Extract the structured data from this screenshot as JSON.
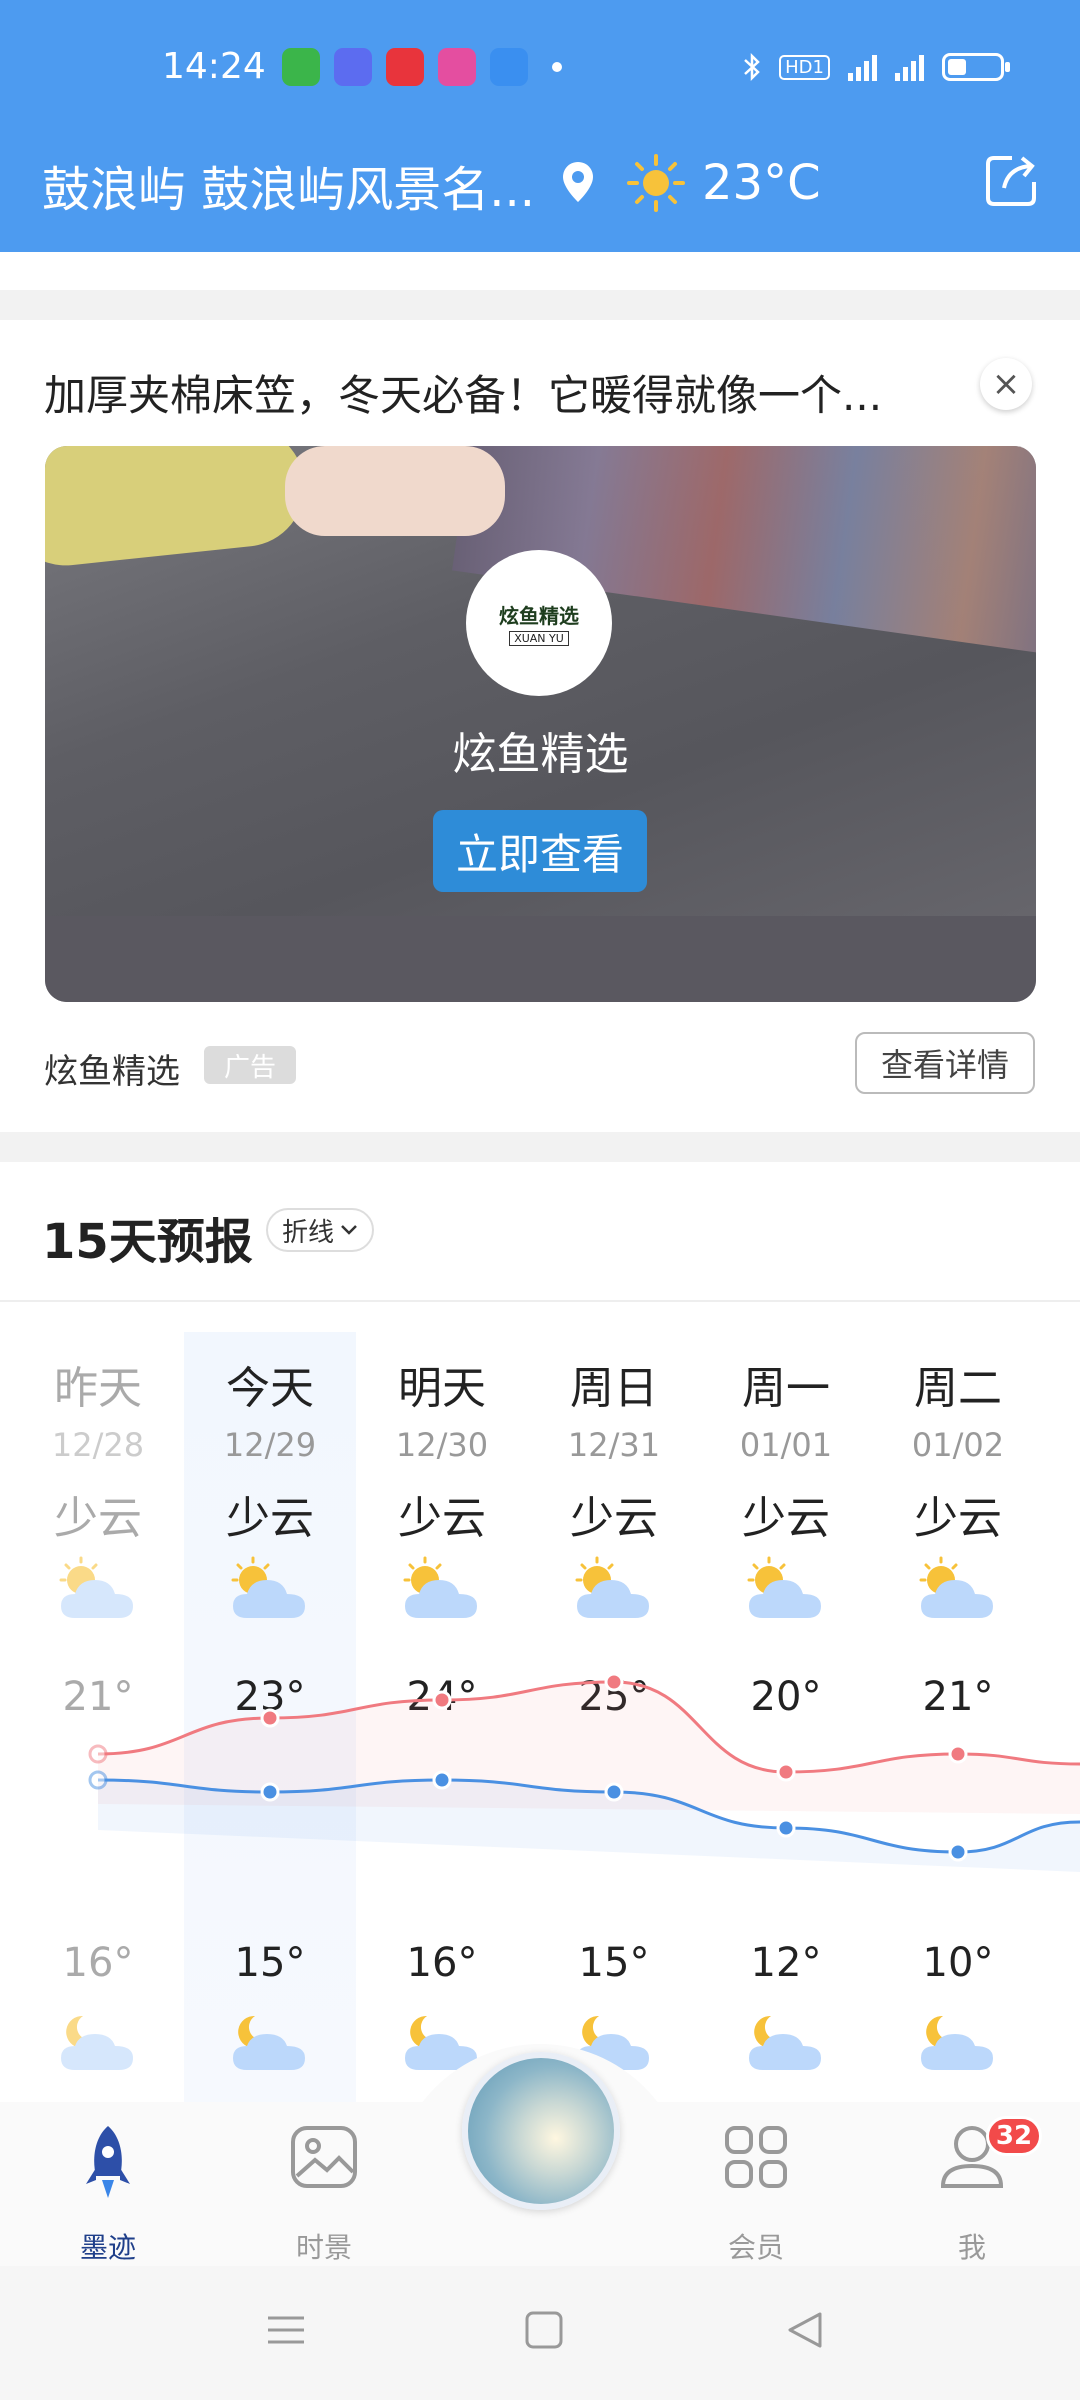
{
  "status_bar": {
    "time": "14:24",
    "app_icons": [
      "#3bb54a",
      "#5c6cf0",
      "#e8343c",
      "#e44ea0",
      "#3a8ff0"
    ],
    "network": "4G",
    "hd_label": "HD1"
  },
  "header": {
    "location": "鼓浪屿 鼓浪屿风景名...",
    "temperature": "23°C",
    "accent_color": "#4d9bf0"
  },
  "ad": {
    "title": "加厚夹棉床笠，冬天必备！它暖得就像一个...",
    "logo_text": "炫鱼精选",
    "logo_sub": "XUAN YU",
    "brand": "炫鱼精选",
    "cta": "立即查看",
    "source": "炫鱼精选",
    "tag": "广告",
    "detail_button": "查看详情"
  },
  "forecast": {
    "title": "15天预报",
    "mode": "折线",
    "days": [
      {
        "name": "昨天",
        "date": "12/28",
        "cond": "少云",
        "hi": "21°",
        "lo": "16°"
      },
      {
        "name": "今天",
        "date": "12/29",
        "cond": "少云",
        "hi": "23°",
        "lo": "15°"
      },
      {
        "name": "明天",
        "date": "12/30",
        "cond": "少云",
        "hi": "24°",
        "lo": "16°"
      },
      {
        "name": "周日",
        "date": "12/31",
        "cond": "少云",
        "hi": "25°",
        "lo": "15°"
      },
      {
        "name": "周一",
        "date": "01/01",
        "cond": "少云",
        "hi": "20°",
        "lo": "12°"
      },
      {
        "name": "周二",
        "date": "01/02",
        "cond": "少云",
        "hi": "21°",
        "lo": "10°"
      }
    ],
    "hi_values": [
      21,
      23,
      24,
      25,
      20,
      21
    ],
    "lo_values": [
      16,
      15,
      16,
      15,
      12,
      10
    ],
    "hi_color": "#f07a80",
    "lo_color": "#4a90e2"
  },
  "nav": {
    "items": [
      {
        "label": "墨迹"
      },
      {
        "label": "时景"
      },
      {
        "label": "会员"
      },
      {
        "label": "我",
        "badge": "32"
      }
    ]
  }
}
